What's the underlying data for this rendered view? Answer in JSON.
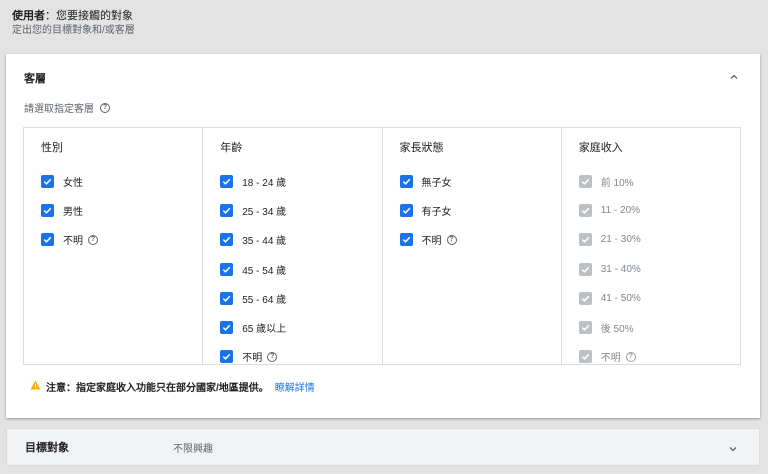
{
  "header": {
    "title_bold": "使用者",
    "title_rest": "：您要接觸的對象",
    "subtitle": "定出您的目標對象和/或客層"
  },
  "demographics": {
    "title": "客層",
    "help_text": "請選取指定客層",
    "columns": [
      {
        "header": "性別",
        "options": [
          {
            "label": "女性",
            "checked": true,
            "disabled": false,
            "help": false
          },
          {
            "label": "男性",
            "checked": true,
            "disabled": false,
            "help": false
          },
          {
            "label": "不明",
            "checked": true,
            "disabled": false,
            "help": true
          }
        ]
      },
      {
        "header": "年齡",
        "options": [
          {
            "label": "18 - 24 歲",
            "checked": true,
            "disabled": false,
            "help": false
          },
          {
            "label": "25 - 34 歲",
            "checked": true,
            "disabled": false,
            "help": false
          },
          {
            "label": "35 - 44 歲",
            "checked": true,
            "disabled": false,
            "help": false
          },
          {
            "label": "45 - 54 歲",
            "checked": true,
            "disabled": false,
            "help": false
          },
          {
            "label": "55 - 64 歲",
            "checked": true,
            "disabled": false,
            "help": false
          },
          {
            "label": "65 歲以上",
            "checked": true,
            "disabled": false,
            "help": false
          },
          {
            "label": "不明",
            "checked": true,
            "disabled": false,
            "help": true
          }
        ]
      },
      {
        "header": "家長狀態",
        "options": [
          {
            "label": "無子女",
            "checked": true,
            "disabled": false,
            "help": false
          },
          {
            "label": "有子女",
            "checked": true,
            "disabled": false,
            "help": false
          },
          {
            "label": "不明",
            "checked": true,
            "disabled": false,
            "help": true
          }
        ]
      },
      {
        "header": "家庭收入",
        "options": [
          {
            "label": "前 10%",
            "checked": true,
            "disabled": true,
            "help": false
          },
          {
            "label": "11 - 20%",
            "checked": true,
            "disabled": true,
            "help": false
          },
          {
            "label": "21 - 30%",
            "checked": true,
            "disabled": true,
            "help": false
          },
          {
            "label": "31 - 40%",
            "checked": true,
            "disabled": true,
            "help": false
          },
          {
            "label": "41 - 50%",
            "checked": true,
            "disabled": true,
            "help": false
          },
          {
            "label": "後 50%",
            "checked": true,
            "disabled": true,
            "help": false
          },
          {
            "label": "不明",
            "checked": true,
            "disabled": true,
            "help": true
          }
        ]
      }
    ],
    "note_text": "注意：指定家庭收入功能只在部分國家/地區提供。",
    "note_link": "瞭解詳情"
  },
  "targeting": {
    "label": "目標對象",
    "value": "不限興趣"
  },
  "colors": {
    "checkbox_enabled": "#1a73e8",
    "checkbox_disabled": "#bdc1c6",
    "link": "#1a73e8",
    "warning": "#f9ab00"
  },
  "icons": {
    "help": "help-circle-icon",
    "collapse": "chevron-up-icon",
    "expand": "chevron-down-icon",
    "warning": "warning-triangle-icon",
    "check": "checkmark-icon"
  }
}
